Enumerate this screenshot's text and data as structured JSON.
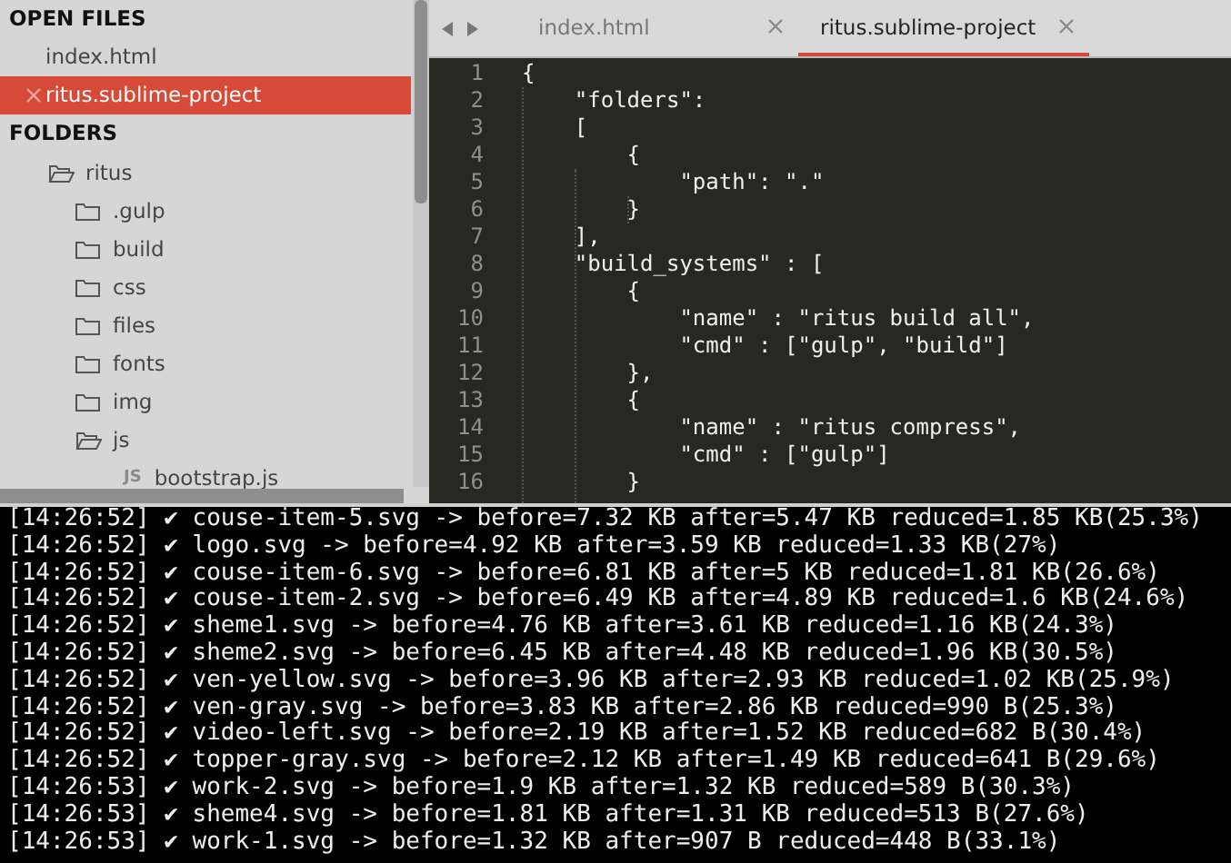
{
  "sidebar": {
    "open_files_header": "OPEN FILES",
    "open_files": [
      {
        "name": "index.html",
        "selected": false
      },
      {
        "name": "ritus.sublime-project",
        "selected": true
      }
    ],
    "folders_header": "FOLDERS",
    "tree": [
      {
        "kind": "folder",
        "name": "ritus",
        "expanded": true,
        "children": [
          {
            "kind": "folder",
            "name": ".gulp",
            "expanded": false
          },
          {
            "kind": "folder",
            "name": "build",
            "expanded": false
          },
          {
            "kind": "folder",
            "name": "css",
            "expanded": false
          },
          {
            "kind": "folder",
            "name": "files",
            "expanded": false
          },
          {
            "kind": "folder",
            "name": "fonts",
            "expanded": false
          },
          {
            "kind": "folder",
            "name": "img",
            "expanded": false
          },
          {
            "kind": "folder",
            "name": "js",
            "expanded": true,
            "children": [
              {
                "kind": "file",
                "name": "bootstrap.js",
                "icon_text": "JS"
              }
            ]
          }
        ]
      }
    ]
  },
  "tabs": [
    {
      "label": "index.html",
      "selected": false
    },
    {
      "label": "ritus.sublime-project",
      "selected": true
    }
  ],
  "editor": {
    "lines": [
      {
        "number": "1",
        "text": "{"
      },
      {
        "number": "2",
        "text": "    \"folders\":"
      },
      {
        "number": "3",
        "text": "    ["
      },
      {
        "number": "4",
        "text": "        {"
      },
      {
        "number": "5",
        "text": "            \"path\": \".\""
      },
      {
        "number": "6",
        "text": "        }"
      },
      {
        "number": "7",
        "text": "    ],"
      },
      {
        "number": "8",
        "text": "    \"build_systems\" : ["
      },
      {
        "number": "9",
        "text": "        {"
      },
      {
        "number": "10",
        "text": "            \"name\" : \"ritus build all\","
      },
      {
        "number": "11",
        "text": "            \"cmd\" : [\"gulp\", \"build\"]"
      },
      {
        "number": "12",
        "text": "        },"
      },
      {
        "number": "13",
        "text": "        {"
      },
      {
        "number": "14",
        "text": "            \"name\" : \"ritus compress\","
      },
      {
        "number": "15",
        "text": "            \"cmd\" : [\"gulp\"]"
      },
      {
        "number": "16",
        "text": "        }"
      }
    ]
  },
  "console": {
    "lines": [
      "[14:26:52] ✔ couse-item-5.svg -> before=7.32 KB after=5.47 KB reduced=1.85 KB(25.3%)",
      "[14:26:52] ✔ logo.svg -> before=4.92 KB after=3.59 KB reduced=1.33 KB(27%)",
      "[14:26:52] ✔ couse-item-6.svg -> before=6.81 KB after=5 KB reduced=1.81 KB(26.6%)",
      "[14:26:52] ✔ couse-item-2.svg -> before=6.49 KB after=4.89 KB reduced=1.6 KB(24.6%)",
      "[14:26:52] ✔ sheme1.svg -> before=4.76 KB after=3.61 KB reduced=1.16 KB(24.3%)",
      "[14:26:52] ✔ sheme2.svg -> before=6.45 KB after=4.48 KB reduced=1.96 KB(30.5%)",
      "[14:26:52] ✔ ven-yellow.svg -> before=3.96 KB after=2.93 KB reduced=1.02 KB(25.9%)",
      "[14:26:52] ✔ ven-gray.svg -> before=3.83 KB after=2.86 KB reduced=990 B(25.3%)",
      "[14:26:52] ✔ video-left.svg -> before=2.19 KB after=1.52 KB reduced=682 B(30.4%)",
      "[14:26:52] ✔ topper-gray.svg -> before=2.12 KB after=1.49 KB reduced=641 B(29.6%)",
      "[14:26:53] ✔ work-2.svg -> before=1.9 KB after=1.32 KB reduced=589 B(30.3%)",
      "[14:26:53] ✔ sheme4.svg -> before=1.81 KB after=1.31 KB reduced=513 B(27.6%)",
      "[14:26:53] ✔ work-1.svg -> before=1.32 KB after=907 B reduced=448 B(33.1%)"
    ]
  }
}
